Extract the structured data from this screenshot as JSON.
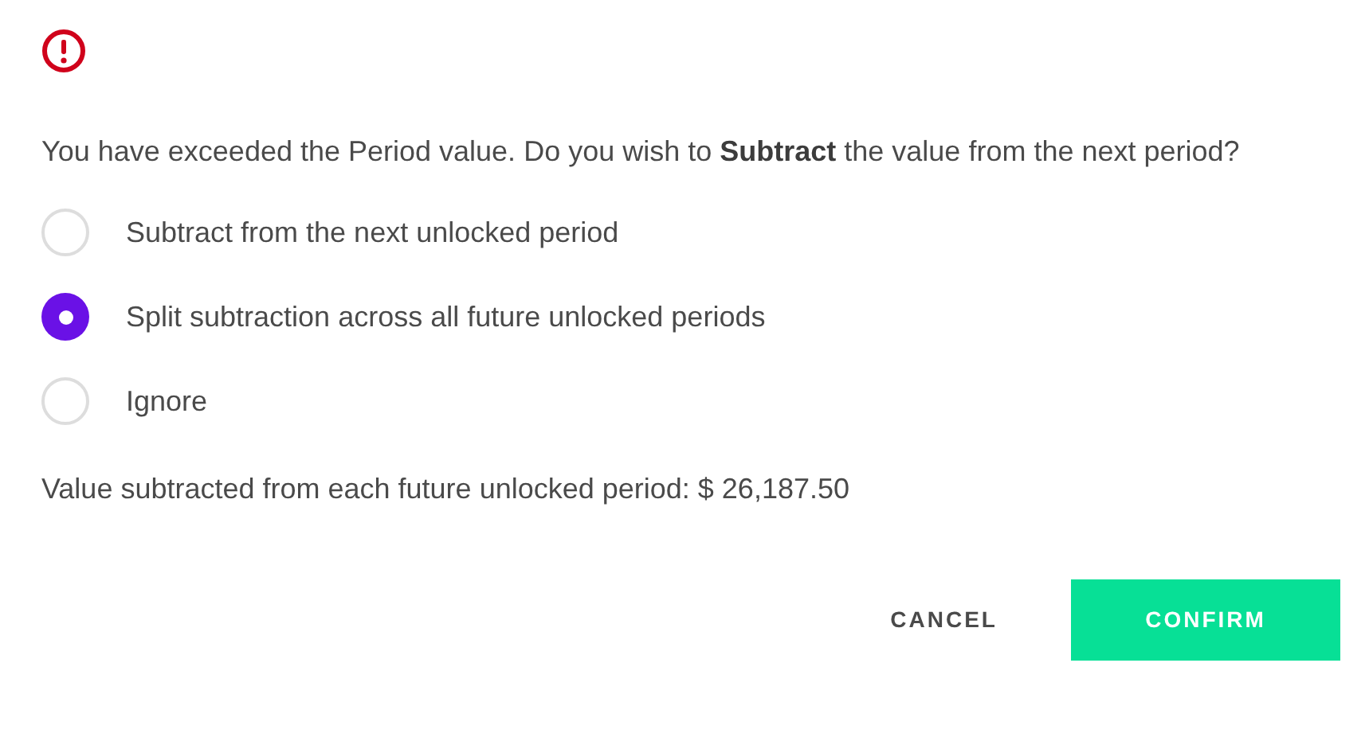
{
  "message": "You have exceeded the Period value. Do you wish to **Subtract** the value from the next period?",
  "options": [
    {
      "label": "Subtract from the next unlocked period",
      "selected": false
    },
    {
      "label": "Split subtraction across all future unlocked periods",
      "selected": true
    },
    {
      "label": "Ignore",
      "selected": false
    }
  ],
  "summary": "Value subtracted from each future unlocked period: $ 26,187.50",
  "buttons": [
    {
      "label": "CANCEL",
      "kind": "text"
    },
    {
      "label": "CONFIRM",
      "kind": "primary"
    }
  ]
}
